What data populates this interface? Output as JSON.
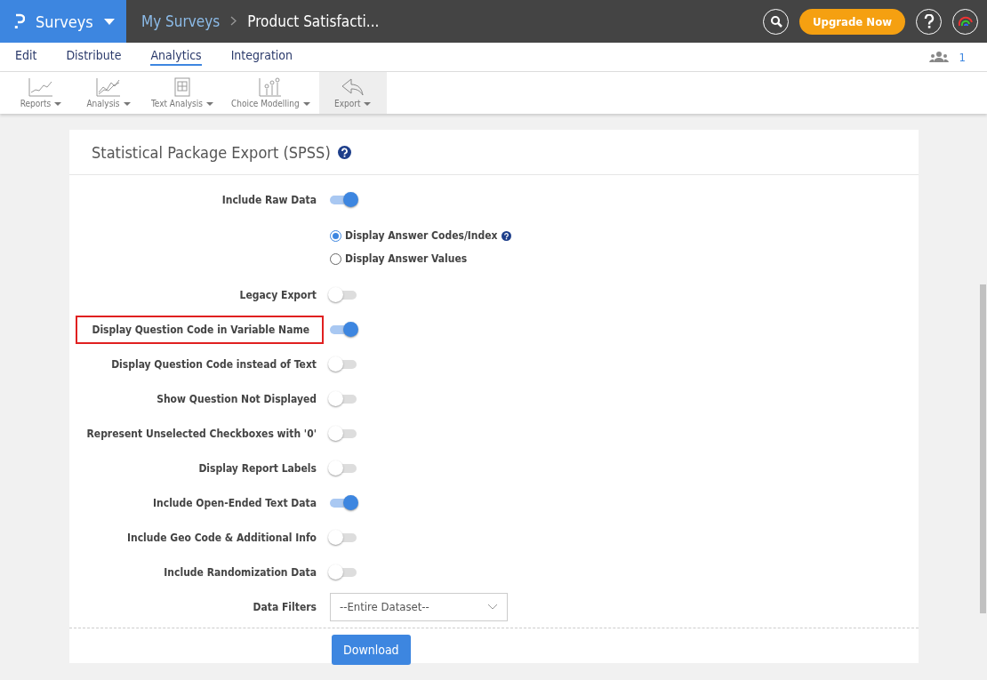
{
  "top_bar": {
    "brand": "Surveys",
    "breadcrumb": [
      {
        "label": "My Surveys",
        "kind": "link"
      },
      {
        "label": "Product Satisfacti...",
        "kind": "current"
      }
    ],
    "upgrade_button": "Upgrade Now"
  },
  "nav_tabs": [
    {
      "label": "Edit",
      "selected": false
    },
    {
      "label": "Distribute",
      "selected": false
    },
    {
      "label": "Analytics",
      "selected": true
    },
    {
      "label": "Integration",
      "selected": false
    }
  ],
  "collaborators": {
    "count": "1"
  },
  "toolbar": [
    {
      "label": "Reports",
      "kind": "reports",
      "selected": false
    },
    {
      "label": "Analysis",
      "kind": "analysis",
      "selected": false
    },
    {
      "label": "Text Analysis",
      "kind": "text",
      "selected": false
    },
    {
      "label": "Choice Modelling",
      "kind": "choice",
      "selected": false
    },
    {
      "label": "Export",
      "kind": "export",
      "selected": true
    }
  ],
  "panel": {
    "title": "Statistical Package Export (SPSS)",
    "rows": [
      {
        "kind": "toggle",
        "label": "Include Raw Data",
        "on": true,
        "highlighted": false
      },
      {
        "kind": "radio_group",
        "options": [
          {
            "label": "Display Answer Codes/Index",
            "selected": true,
            "help": true
          },
          {
            "label": "Display Answer Values",
            "selected": false,
            "help": false
          }
        ]
      },
      {
        "kind": "toggle",
        "label": "Legacy Export",
        "on": false,
        "highlighted": false
      },
      {
        "kind": "toggle",
        "label": "Display Question Code in Variable Name",
        "on": true,
        "highlighted": true
      },
      {
        "kind": "toggle",
        "label": "Display Question Code instead of Text",
        "on": false,
        "highlighted": false
      },
      {
        "kind": "toggle",
        "label": "Show Question Not Displayed",
        "on": false,
        "highlighted": false
      },
      {
        "kind": "toggle",
        "label": "Represent Unselected Checkboxes with '0'",
        "on": false,
        "highlighted": false
      },
      {
        "kind": "toggle",
        "label": "Display Report Labels",
        "on": false,
        "highlighted": false
      },
      {
        "kind": "toggle",
        "label": "Include Open-Ended Text Data",
        "on": true,
        "highlighted": false
      },
      {
        "kind": "toggle",
        "label": "Include Geo Code & Additional Info",
        "on": false,
        "highlighted": false
      },
      {
        "kind": "toggle",
        "label": "Include Randomization Data",
        "on": false,
        "highlighted": false
      },
      {
        "kind": "select",
        "label": "Data Filters",
        "value": "--Entire Dataset--"
      }
    ],
    "download_button": "Download"
  }
}
